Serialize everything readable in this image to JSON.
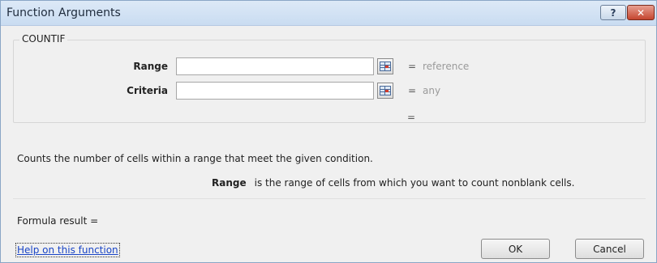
{
  "window": {
    "title": "Function Arguments",
    "help_glyph": "?",
    "close_glyph": "✕"
  },
  "function": {
    "name": "COUNTIF",
    "args": [
      {
        "label": "Range",
        "value": "",
        "equals": "=",
        "result_hint": "reference"
      },
      {
        "label": "Criteria",
        "value": "",
        "equals": "=",
        "result_hint": "any"
      }
    ],
    "overall_equals": "="
  },
  "description": "Counts the number of cells within a range that meet the given condition.",
  "arg_help": {
    "name": "Range",
    "text": "is the range of cells from which you want to count nonblank cells."
  },
  "formula_result": "Formula result =",
  "help_link": "Help on this function",
  "buttons": {
    "ok": "OK",
    "cancel": "Cancel"
  },
  "icons": {
    "collapse": "collapse-dialog-icon"
  }
}
